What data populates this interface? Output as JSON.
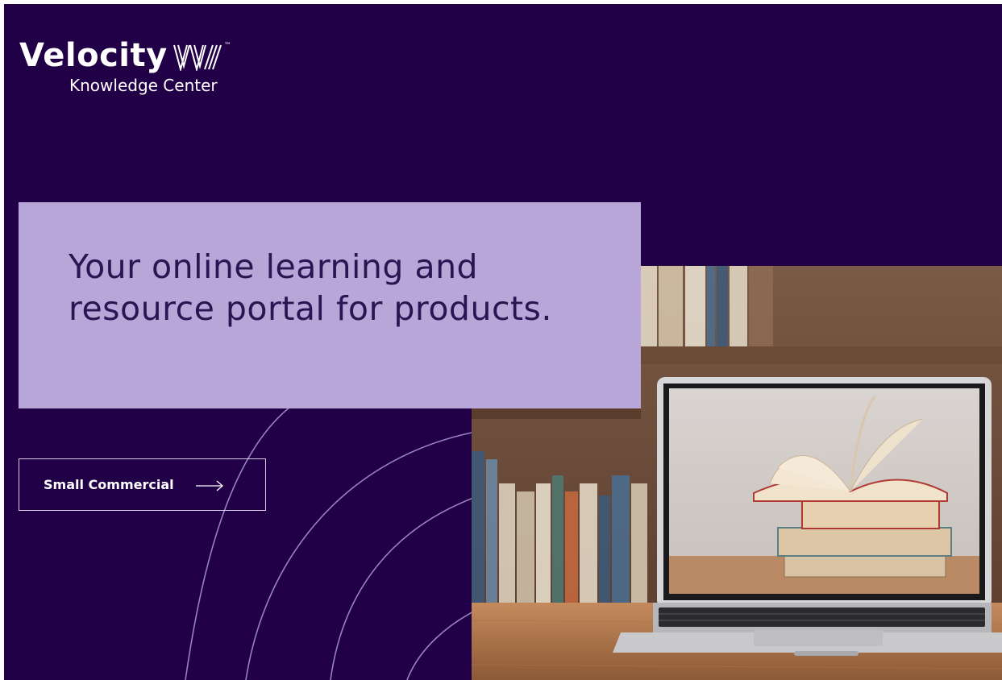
{
  "brand": {
    "name": "Velocity",
    "trademark": "™",
    "subtitle": "Knowledge Center"
  },
  "hero": {
    "headline": "Your online learning and resource portal for products."
  },
  "cta": {
    "label": "Small Commercial",
    "icon": "arrow-right-icon"
  },
  "colors": {
    "background": "#220047",
    "hero_box": "#b9a6d9",
    "hero_text": "#2a1451",
    "button_border": "#d9cdea"
  }
}
